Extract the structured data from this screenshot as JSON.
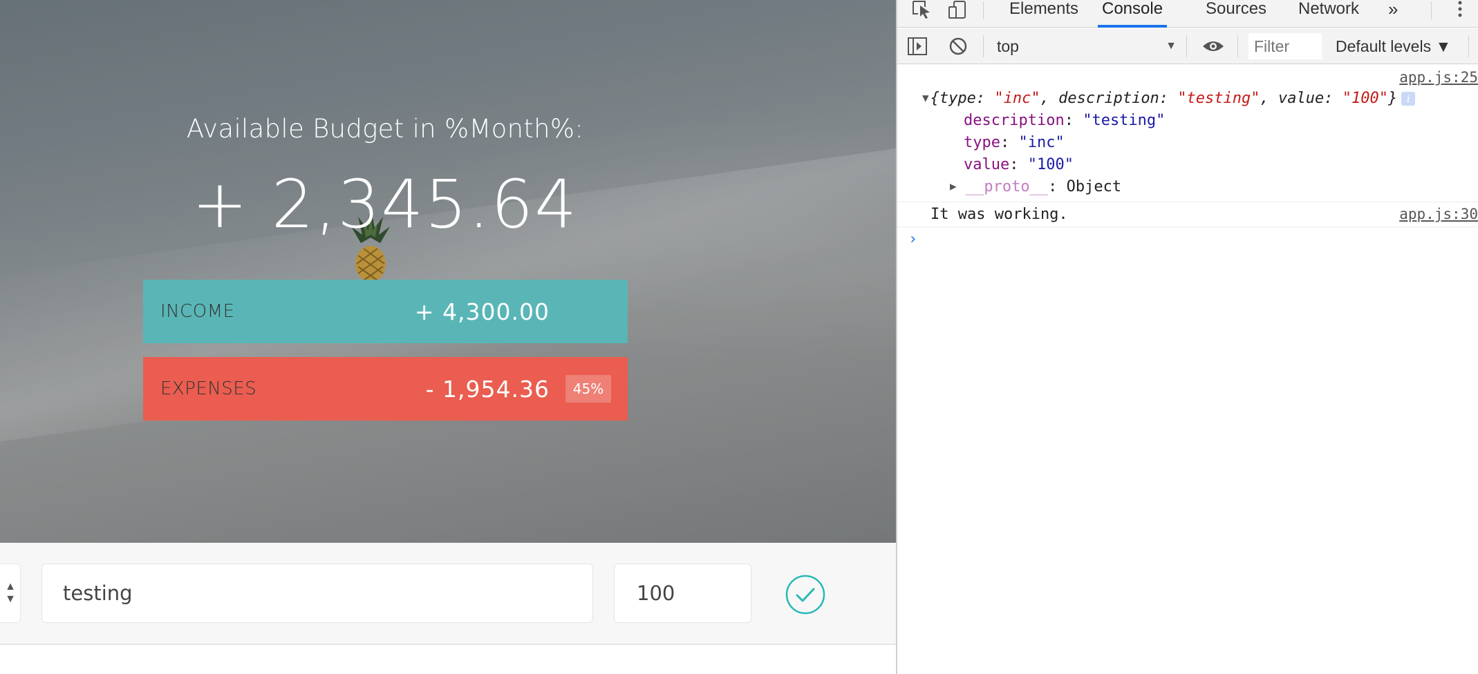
{
  "app": {
    "budget_title": "Available Budget in %Month%:",
    "budget_value": "+ 2,345.64",
    "income": {
      "label": "INCOME",
      "value": "+ 4,300.00"
    },
    "expenses": {
      "label": "EXPENSES",
      "value": "- 1,954.36",
      "percentage": "45%"
    },
    "add_form": {
      "description_value": "testing",
      "value_value": "100",
      "add_button_icon": "checkmark-circle-icon"
    },
    "colors": {
      "income": "#5ab6b6",
      "expenses": "#ea5d50",
      "accent": "#28b9b5"
    }
  },
  "devtools": {
    "tabs": [
      "Elements",
      "Console",
      "Sources",
      "Network"
    ],
    "active_tab": "Console",
    "more_tabs": "»",
    "context": "top",
    "filter_placeholder": "Filter",
    "levels": "Default levels ▼",
    "messages": [
      {
        "source": "app.js:25",
        "summary": {
          "open": "{",
          "k1": "type",
          "v1": "\"inc\"",
          "k2": "description",
          "v2": "\"testing\"",
          "k3": "value",
          "v3": "\"100\"",
          "close": "}"
        },
        "props": [
          {
            "key": "description",
            "value": "\"testing\""
          },
          {
            "key": "type",
            "value": "\"inc\""
          },
          {
            "key": "value",
            "value": "\"100\""
          }
        ],
        "proto": {
          "key": "__proto__",
          "value": "Object"
        }
      },
      {
        "source": "app.js:30",
        "text": "It was working."
      }
    ],
    "prompt": "›"
  }
}
